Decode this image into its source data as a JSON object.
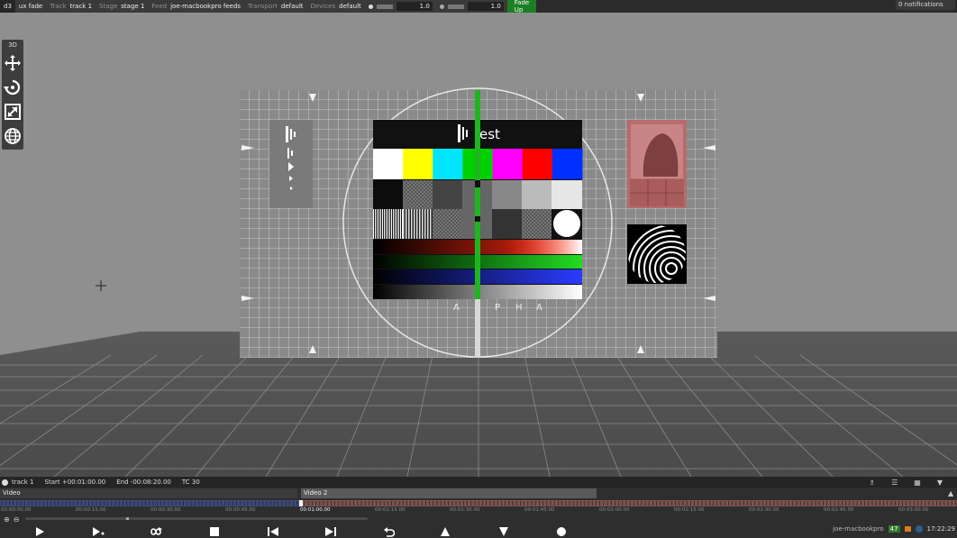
{
  "topbar": {
    "project": "d3",
    "preset": "ux fade",
    "track_label": "Track",
    "track_value": "track 1",
    "stage_label": "Stage",
    "stage_value": "stage 1",
    "feed_label": "Feed",
    "feed_value": "joe-macbookpro feeds",
    "transport_label": "Transport",
    "transport_value": "default",
    "devices_label": "Devices",
    "devices_value": "default",
    "volume_value": "1.0",
    "brightness_value": "1.0",
    "fade_up_label": "Fade Up",
    "accent_color": "#1a7f25"
  },
  "notifications": {
    "label": "0 notifications"
  },
  "toolbox": {
    "title": "3D",
    "tools": [
      "move-icon",
      "rotate-icon",
      "scale-icon",
      "globe-icon"
    ]
  },
  "test_card": {
    "brand_text": "est",
    "alpha_letters": [
      "A",
      "L",
      "P",
      "H",
      "A"
    ],
    "color_bars": [
      "#ffffff",
      "#ffff00",
      "#00e5ff",
      "#00d000",
      "#ff00ff",
      "#ff0000",
      "#0030ff"
    ]
  },
  "timeline": {
    "track_name": "track 1",
    "start": "Start +00:01:00.00",
    "end": "End -00:08:20.00",
    "tc": "TC 30",
    "layers": [
      {
        "label": "Video"
      },
      {
        "label": "Video 2"
      }
    ],
    "ruler_ticks": [
      "00:00:00.00",
      "00:00:15.00",
      "00:00:30.00",
      "00:00:45.00",
      "00:01:00.00",
      "00:01:15.00",
      "00:01:30.00",
      "00:01:45.00",
      "00:02:00.00",
      "00:02:15.00",
      "00:02:30.00",
      "00:02:45.00",
      "00:03:00.00"
    ],
    "playhead_time": "00:01:00.00"
  },
  "status": {
    "host": "joe-macbookpro",
    "fps": "47",
    "clock": "17:22:29"
  }
}
